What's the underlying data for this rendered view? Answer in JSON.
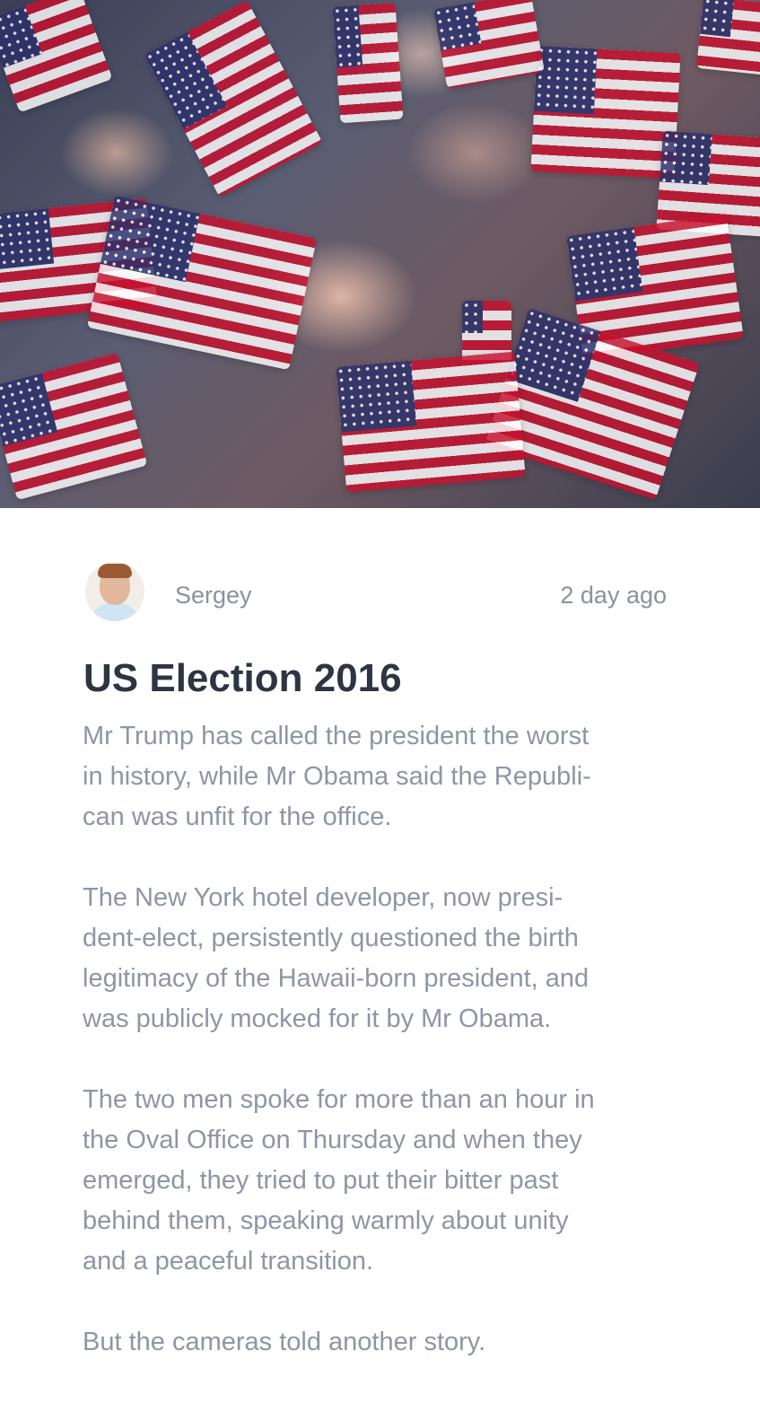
{
  "hero": {
    "icon": "flags-crowd-photo"
  },
  "post": {
    "author": "Sergey",
    "time": "2 day ago",
    "title": "US Election 2016",
    "paragraphs": [
      "Mr Trump has called the president the worst\nin history, while Mr Obama said the Republi-\ncan was unfit for the office.",
      "The New York hotel developer, now presi-\ndent-elect, persistently questioned the birth\nlegitimacy of the Hawaii-born president, and\nwas publicly mocked for it by Mr Obama.",
      "The two men spoke for more than an hour in\nthe Oval Office on Thursday and when they\nemerged, they tried to put their bitter past\nbehind them, speaking warmly about unity\nand a peaceful transition.",
      "But the cameras told another story."
    ]
  },
  "colors": {
    "title": "#2d3543",
    "text": "#8f95a6",
    "meta": "#8c90a0",
    "flag_red": "#c8102e",
    "flag_blue": "#2b2f6b"
  }
}
